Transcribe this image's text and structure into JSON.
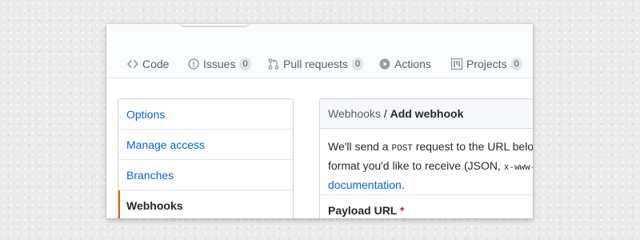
{
  "repo_nav": {
    "tabs": [
      {
        "label": "Code",
        "icon": "code-icon"
      },
      {
        "label": "Issues",
        "icon": "issue-opened-icon",
        "count": "0"
      },
      {
        "label": "Pull requests",
        "icon": "git-pull-request-icon",
        "count": "0"
      },
      {
        "label": "Actions",
        "icon": "play-icon"
      },
      {
        "label": "Projects",
        "icon": "project-icon",
        "count": "0"
      }
    ]
  },
  "settings_menu": {
    "items": [
      {
        "label": "Options"
      },
      {
        "label": "Manage access"
      },
      {
        "label": "Branches"
      },
      {
        "label": "Webhooks",
        "active": true
      }
    ]
  },
  "webhook_box": {
    "breadcrumb_parent": "Webhooks",
    "breadcrumb_sep": " / ",
    "breadcrumb_current": "Add webhook",
    "desc_line1_a": "We'll send a ",
    "desc_line1_code": "POST",
    "desc_line1_b": " request to the URL below",
    "desc_line2_a": "format you'd like to receive (JSON, ",
    "desc_line2_code": "x-www-",
    "desc_line3_link": "documentation",
    "desc_line3_b": ".",
    "payload_label": "Payload URL",
    "required_mark": "*"
  },
  "colors": {
    "link": "#0366d6",
    "active_marker": "#e36209",
    "required": "#cb2431",
    "text": "#24292e",
    "muted": "#586069"
  }
}
